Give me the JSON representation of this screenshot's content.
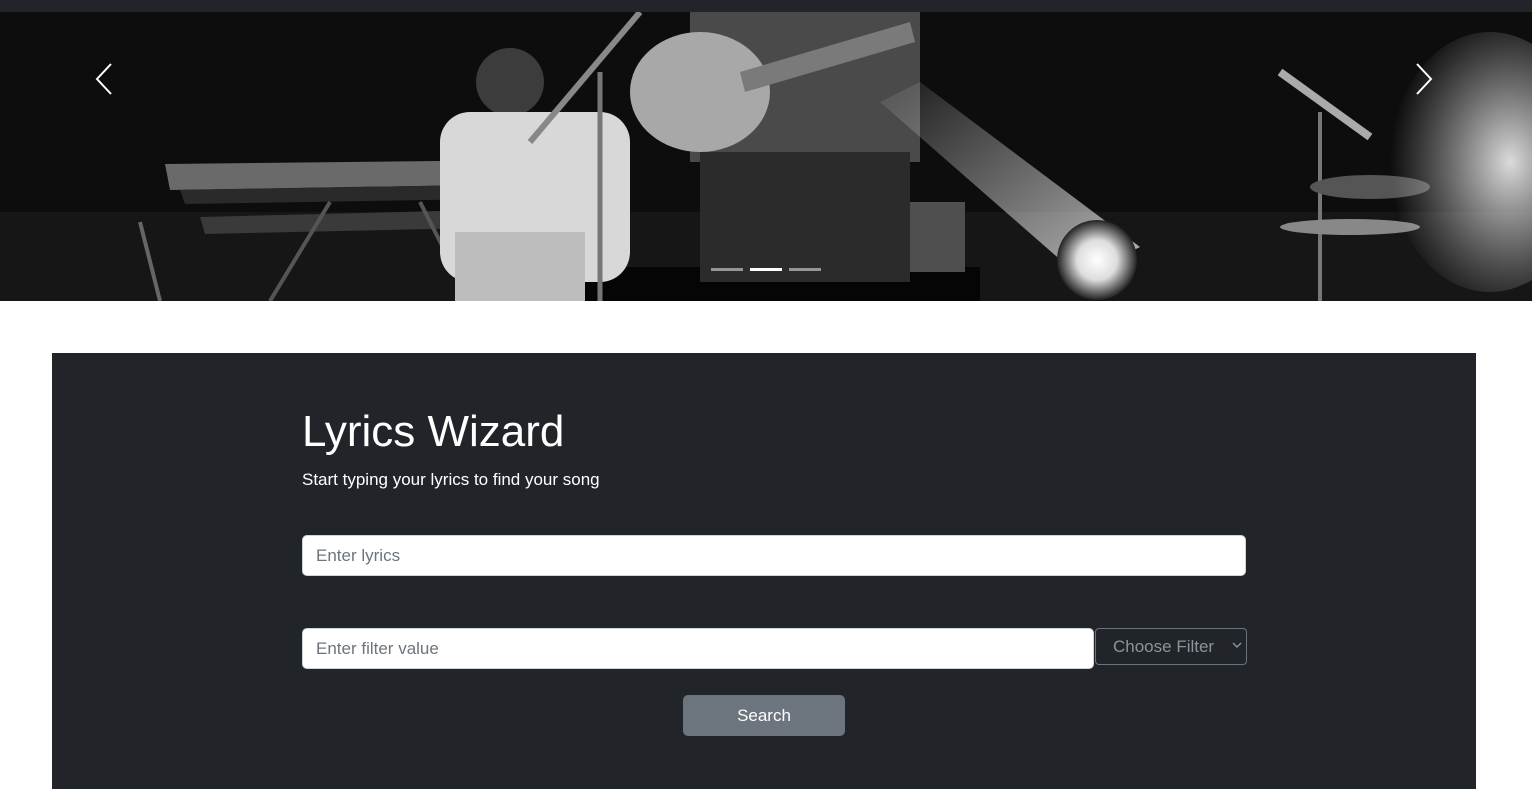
{
  "carousel": {
    "prev_icon": "chevron-left-icon",
    "next_icon": "chevron-right-icon",
    "slide_count": 3,
    "active_slide": 2
  },
  "hero": {
    "title": "Lyrics Wizard",
    "subtitle": "Start typing your lyrics to find your song"
  },
  "form": {
    "lyrics_placeholder": "Enter lyrics",
    "lyrics_value": "",
    "filter_placeholder": "Enter filter value",
    "filter_value": "",
    "filter_select_label": "Choose Filter",
    "filter_select_icon": "chevron-down-icon",
    "search_label": "Search"
  },
  "colors": {
    "dark_bg": "#212529",
    "button_bg": "#6c757d",
    "text_light": "#ffffff"
  }
}
